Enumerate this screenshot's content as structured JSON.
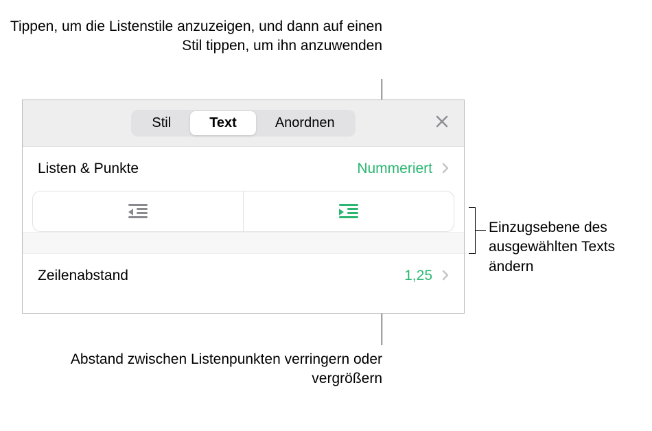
{
  "callouts": {
    "top": "Tippen, um die Listenstile anzuzeigen, und dann auf einen Stil tippen, um ihn anzuwenden",
    "right": "Einzugsebene des ausgewählten Texts ändern",
    "bottom": "Abstand zwischen Listenpunkten verringern oder vergrößern"
  },
  "tabs": {
    "stil": "Stil",
    "text": "Text",
    "anordnen": "Anordnen"
  },
  "rows": {
    "lists_label": "Listen & Punkte",
    "lists_value": "Nummeriert",
    "spacing_label": "Zeilenabstand",
    "spacing_value": "1,25"
  }
}
